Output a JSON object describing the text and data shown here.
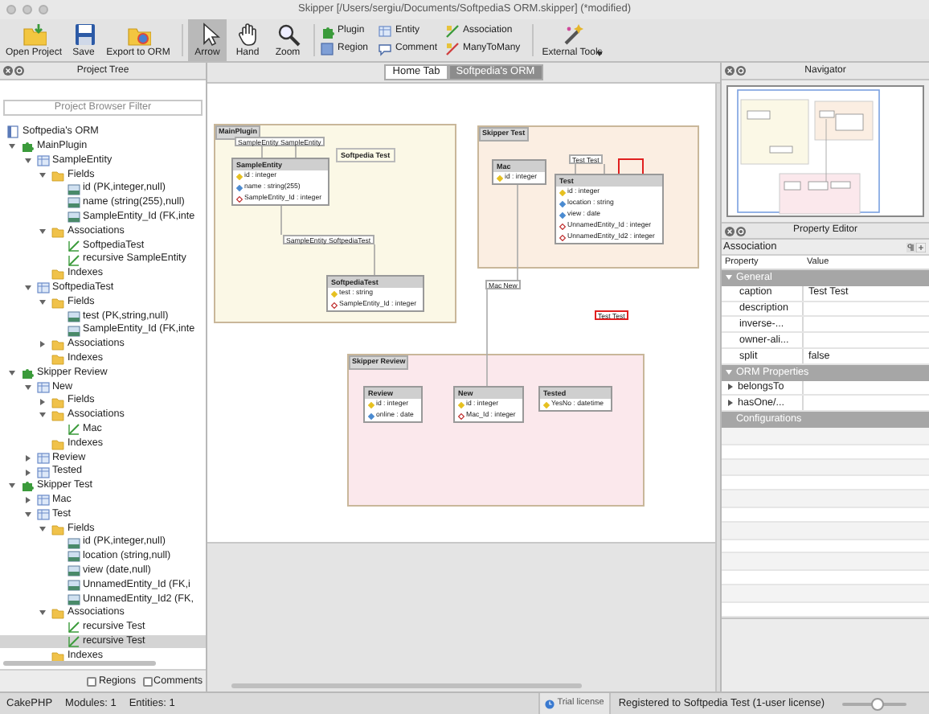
{
  "window": {
    "title": "Skipper [/Users/sergiu/Documents/SoftpediaS ORM.skipper] (*modified)"
  },
  "toolbar": {
    "file_buttons": [
      {
        "label": "Open Project"
      },
      {
        "label": "Save"
      },
      {
        "label": "Export to ORM"
      }
    ],
    "tools": [
      {
        "label": "Arrow",
        "selected": true
      },
      {
        "label": "Hand",
        "selected": false
      },
      {
        "label": "Zoom",
        "selected": false
      }
    ],
    "insert_buttons": [
      {
        "label": "Plugin"
      },
      {
        "label": "Region"
      },
      {
        "label": "Entity"
      },
      {
        "label": "Comment"
      },
      {
        "label": "Association"
      },
      {
        "label": "ManyToMany"
      }
    ],
    "external_tools": {
      "label": "External Tools"
    }
  },
  "project_tree": {
    "title": "Project Tree",
    "filter_placeholder": "Project Browser Filter",
    "tree": [
      {
        "label": "Softpedia's ORM",
        "kind": "project",
        "selected": false,
        "children": [
          {
            "label": "MainPlugin",
            "kind": "module",
            "expanded": true,
            "selected": false,
            "children": [
              {
                "label": "SampleEntity",
                "kind": "entity",
                "expanded": true,
                "selected": false,
                "children": [
                  {
                    "label": "Fields",
                    "kind": "folder",
                    "expanded": true,
                    "selected": false,
                    "children": [
                      {
                        "label": "id (PK,integer,null)",
                        "kind": "field",
                        "selected": false
                      },
                      {
                        "label": "name (string(255),null)",
                        "kind": "field",
                        "selected": false
                      },
                      {
                        "label": "SampleEntity_Id (FK,inte",
                        "kind": "field",
                        "selected": false
                      }
                    ]
                  },
                  {
                    "label": "Associations",
                    "kind": "folder",
                    "expanded": true,
                    "selected": false,
                    "children": [
                      {
                        "label": "SoftpediaTest",
                        "kind": "association",
                        "selected": false
                      },
                      {
                        "label": "recursive SampleEntity",
                        "kind": "association",
                        "selected": false
                      }
                    ]
                  },
                  {
                    "label": "Indexes",
                    "kind": "folder",
                    "selected": false
                  }
                ]
              },
              {
                "label": "SoftpediaTest",
                "kind": "entity",
                "expanded": true,
                "selected": false,
                "children": [
                  {
                    "label": "Fields",
                    "kind": "folder",
                    "expanded": true,
                    "selected": false,
                    "children": [
                      {
                        "label": "test (PK,string,null)",
                        "kind": "field",
                        "selected": false
                      },
                      {
                        "label": "SampleEntity_Id (FK,inte",
                        "kind": "field",
                        "selected": false
                      }
                    ]
                  },
                  {
                    "label": "Associations",
                    "kind": "folder",
                    "expanded": false,
                    "selected": false
                  },
                  {
                    "label": "Indexes",
                    "kind": "folder",
                    "selected": false
                  }
                ]
              }
            ]
          },
          {
            "label": "Skipper Review",
            "kind": "module",
            "expanded": true,
            "selected": false,
            "children": [
              {
                "label": "New",
                "kind": "entity",
                "expanded": true,
                "selected": false,
                "children": [
                  {
                    "label": "Fields",
                    "kind": "folder",
                    "expanded": false,
                    "selected": false
                  },
                  {
                    "label": "Associations",
                    "kind": "folder",
                    "expanded": true,
                    "selected": false,
                    "children": [
                      {
                        "label": "Mac",
                        "kind": "association",
                        "selected": false
                      }
                    ]
                  },
                  {
                    "label": "Indexes",
                    "kind": "folder",
                    "selected": false
                  }
                ]
              },
              {
                "label": "Review",
                "kind": "entity",
                "expanded": false,
                "selected": false
              },
              {
                "label": "Tested",
                "kind": "entity",
                "expanded": false,
                "selected": false
              }
            ]
          },
          {
            "label": "Skipper Test",
            "kind": "module",
            "expanded": true,
            "selected": false,
            "children": [
              {
                "label": "Mac",
                "kind": "entity",
                "expanded": false,
                "selected": false
              },
              {
                "label": "Test",
                "kind": "entity",
                "expanded": true,
                "selected": false,
                "children": [
                  {
                    "label": "Fields",
                    "kind": "folder",
                    "expanded": true,
                    "selected": false,
                    "children": [
                      {
                        "label": "id (PK,integer,null)",
                        "kind": "field",
                        "selected": false
                      },
                      {
                        "label": "location (string,null)",
                        "kind": "field",
                        "selected": false
                      },
                      {
                        "label": "view (date,null)",
                        "kind": "field",
                        "selected": false
                      },
                      {
                        "label": "UnnamedEntity_Id (FK,i",
                        "kind": "field",
                        "selected": false
                      },
                      {
                        "label": "UnnamedEntity_Id2 (FK,",
                        "kind": "field",
                        "selected": false
                      }
                    ]
                  },
                  {
                    "label": "Associations",
                    "kind": "folder",
                    "expanded": true,
                    "selected": false,
                    "children": [
                      {
                        "label": "recursive Test",
                        "kind": "association",
                        "selected": false
                      },
                      {
                        "label": "recursive Test",
                        "kind": "association",
                        "selected": true
                      }
                    ]
                  },
                  {
                    "label": "Indexes",
                    "kind": "folder",
                    "selected": false
                  }
                ]
              }
            ]
          }
        ]
      }
    ],
    "checkboxes": [
      {
        "label": "Regions",
        "checked": false
      },
      {
        "label": "Comments",
        "checked": false
      }
    ]
  },
  "tabs": [
    {
      "label": "Home Tab",
      "selected": false
    },
    {
      "label": "Softpedia's ORM",
      "selected": true
    }
  ],
  "diagram": {
    "regions": [
      {
        "title": "MainPlugin",
        "color": "#fbf8e6"
      },
      {
        "title": "Skipper Test",
        "color": "#fbeee2"
      },
      {
        "title": "Skipper Review",
        "color": "#fbe8ec"
      }
    ],
    "tables": [
      {
        "title": "SampleEntity",
        "fields": [
          {
            "name": "id : integer",
            "kind": "primary"
          },
          {
            "name": "name : string(255)",
            "kind": "field"
          },
          {
            "name": "SampleEntity_Id : integer",
            "kind": "foreign"
          }
        ]
      },
      {
        "title": "SoftpediaTest",
        "fields": [
          {
            "name": "test : string",
            "kind": "primary"
          },
          {
            "name": "SampleEntity_Id : integer",
            "kind": "foreign"
          }
        ]
      },
      {
        "title": "Mac",
        "fields": [
          {
            "name": "id : integer",
            "kind": "primary"
          }
        ]
      },
      {
        "title": "Test",
        "fields": [
          {
            "name": "id : integer",
            "kind": "primary"
          },
          {
            "name": "location : string",
            "kind": "field"
          },
          {
            "name": "view : date",
            "kind": "field"
          },
          {
            "name": "UnnamedEntity_Id : integer",
            "kind": "foreign"
          },
          {
            "name": "UnnamedEntity_Id2 : integer",
            "kind": "foreign"
          }
        ]
      },
      {
        "title": "Review",
        "fields": [
          {
            "name": "id : integer",
            "kind": "primary"
          },
          {
            "name": "online : date",
            "kind": "field"
          }
        ]
      },
      {
        "title": "New",
        "fields": [
          {
            "name": "id : integer",
            "kind": "primary"
          },
          {
            "name": "Mac_Id : integer",
            "kind": "foreign"
          }
        ]
      },
      {
        "title": "Tested",
        "fields": [
          {
            "name": "YesNo : datetime",
            "kind": "primary"
          }
        ]
      }
    ],
    "associations": [
      {
        "label": "SampleEntity SampleEntity",
        "selected": false
      },
      {
        "label": "SampleEntity SoftpediaTest",
        "selected": false
      },
      {
        "label": "Test Test",
        "selected": false
      },
      {
        "label": "Mac New",
        "selected": false
      },
      {
        "label": "Test Test",
        "selected": true
      }
    ],
    "comments": [
      {
        "text": "Softpedia Test"
      }
    ]
  },
  "navigator": {
    "title": "Navigator"
  },
  "property_editor": {
    "title": "Property Editor",
    "object": "Association",
    "columns": [
      "Property",
      "Value"
    ],
    "groups": [
      {
        "label": "General",
        "expanded": true,
        "rows": [
          {
            "property": "caption",
            "value": "Test Test"
          },
          {
            "property": "description"
          },
          {
            "property": "inverse-..."
          },
          {
            "property": "owner-ali..."
          },
          {
            "property": "split",
            "value": "false"
          }
        ]
      },
      {
        "label": "ORM Properties",
        "expanded": true,
        "rows": [
          {
            "property": "belongsTo",
            "expanded": false
          },
          {
            "property": "hasOne/...",
            "expanded": false
          }
        ]
      },
      {
        "label": "Configurations"
      }
    ]
  },
  "status_bar": {
    "framework": "CakePHP",
    "modules": "Modules: 1",
    "entities": "Entities: 1",
    "license": "Trial license",
    "registration": "Registered to Softpedia Test (1-user license)",
    "zoom": {
      "level": 0.55
    }
  }
}
